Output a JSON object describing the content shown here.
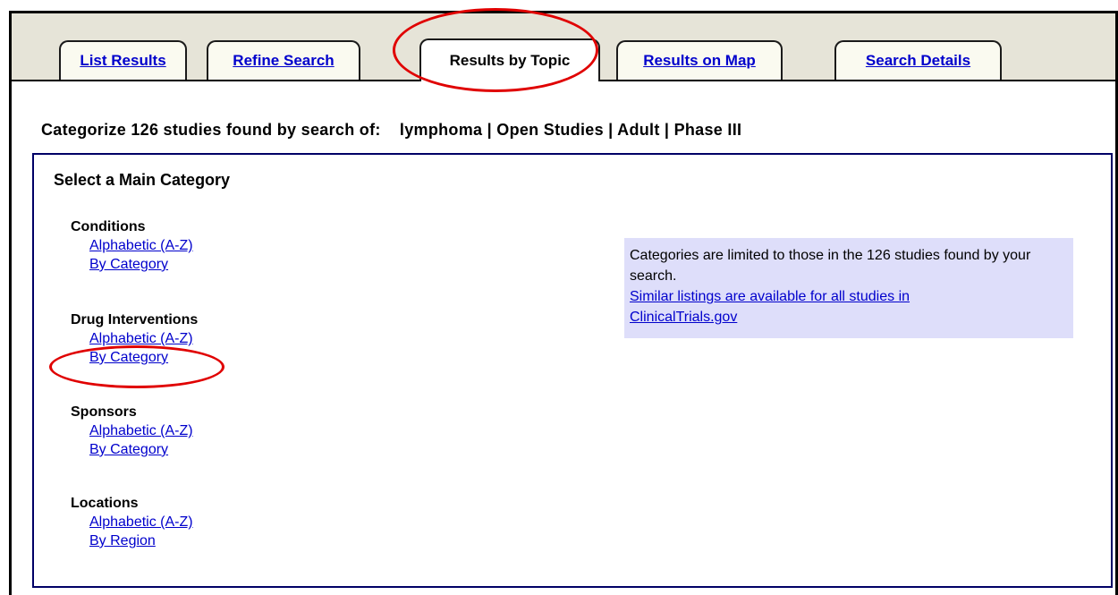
{
  "tabs": [
    {
      "label": "List Results",
      "active": false
    },
    {
      "label": "Refine Search",
      "active": false
    },
    {
      "label": "Results by Topic",
      "active": true
    },
    {
      "label": "Results on Map",
      "active": false
    },
    {
      "label": "Search Details",
      "active": false
    }
  ],
  "summary": {
    "prefix": "Categorize 126 studies found by search of:",
    "query": "lymphoma | Open Studies | Adult | Phase III"
  },
  "panel": {
    "title": "Select a Main Category",
    "groups": [
      {
        "heading": "Conditions",
        "links": [
          "Alphabetic (A-Z)",
          "By Category"
        ]
      },
      {
        "heading": "Drug Interventions",
        "links": [
          "Alphabetic (A-Z)",
          "By Category"
        ]
      },
      {
        "heading": "Sponsors",
        "links": [
          "Alphabetic (A-Z)",
          "By Category"
        ]
      },
      {
        "heading": "Locations",
        "links": [
          "Alphabetic (A-Z)",
          "By Region"
        ]
      }
    ],
    "note": {
      "text": "Categories are limited to those in the 126 studies found by your search.",
      "link_line1": "Similar listings are available for all studies in",
      "link_line2": "ClinicalTrials.gov"
    }
  },
  "colors": {
    "link": "#0000cc",
    "highlight": "#e00000",
    "note_bg": "#dedefa",
    "tabstrip_bg": "#e6e4d8"
  }
}
